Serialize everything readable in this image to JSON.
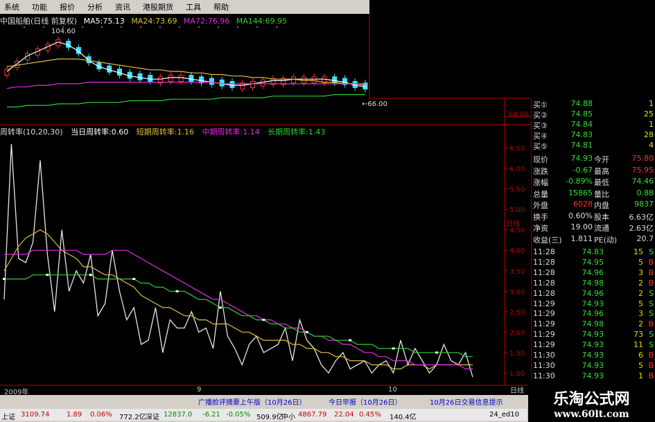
{
  "menu": [
    "系统",
    "功能",
    "报价",
    "分析",
    "资讯",
    "港股期货",
    "工具",
    "帮助"
  ],
  "kline_header": {
    "stock": "中国船舶(日线 前复权)",
    "ma5": "MA5:75.13",
    "ma24": "MA24:73.69",
    "ma72": "MA72:76.96",
    "ma144": "MA144:69.95",
    "high_mark": "104.60",
    "low_mark": "←66.00"
  },
  "indicator_header": {
    "name": "周转率(10,20,30)",
    "today": "当日周转率:0.60",
    "short": "短期周转率:1.16",
    "mid": "中期周转率:1.14",
    "long": "长期周转率:1.43"
  },
  "axis_top": {
    "label": "60.00"
  },
  "axis_indicator": [
    "6.50",
    "6.00",
    "5.50",
    "5.00",
    "4.50",
    "4.00",
    "3.50",
    "3.00",
    "2.50",
    "2.00",
    "1.50",
    "1.00"
  ],
  "axis_corner": [
    "日线",
    "日线"
  ],
  "date_axis": {
    "d1": "2009年",
    "d2": "9",
    "d3": "10"
  },
  "colors": {
    "ma5": "#ffffff",
    "ma24": "#e0c040",
    "ma72": "#e030e0",
    "ma144": "#30d030",
    "up": "#ff3030",
    "down": "#40e0ff",
    "axis": "#c00000"
  },
  "quote": {
    "bids": [
      {
        "label": "买①",
        "price": "74.88",
        "vol": "1"
      },
      {
        "label": "买②",
        "price": "74.85",
        "vol": "25"
      },
      {
        "label": "买③",
        "price": "74.84",
        "vol": "1"
      },
      {
        "label": "买④",
        "price": "74.83",
        "vol": "28"
      },
      {
        "label": "买⑤",
        "price": "74.81",
        "vol": "4"
      }
    ],
    "stats": [
      {
        "k1": "现价",
        "v1": "74.93",
        "k2": "今开",
        "v2": "75.80"
      },
      {
        "k1": "涨跌",
        "v1": "-0.67",
        "k2": "最高",
        "v2": "75.95"
      },
      {
        "k1": "涨幅",
        "v1": "-0.89%",
        "k2": "最低",
        "v2": "74.46"
      },
      {
        "k1": "总量",
        "v1": "15865",
        "k2": "量比",
        "v2": "0.88"
      },
      {
        "k1": "外盘",
        "v1": "6028",
        "k2": "内盘",
        "v2": "9837"
      },
      {
        "k1": "换手",
        "v1": "0.60%",
        "k2": "股本",
        "v2": "6.63亿"
      },
      {
        "k1": "净资",
        "v1": "19.00",
        "k2": "流通",
        "v2": "2.63亿"
      },
      {
        "k1": "收益(三)",
        "v1": "1.811",
        "k2": "PE(动)",
        "v2": "20.7"
      }
    ],
    "ticks": [
      {
        "t": "11:28",
        "p": "74.83",
        "v": "15",
        "s": "S"
      },
      {
        "t": "11:28",
        "p": "74.95",
        "v": "5",
        "s": "B"
      },
      {
        "t": "11:28",
        "p": "74.96",
        "v": "3",
        "s": "B"
      },
      {
        "t": "11:28",
        "p": "74.98",
        "v": "2",
        "s": "B"
      },
      {
        "t": "11:28",
        "p": "74.96",
        "v": "2",
        "s": "S"
      },
      {
        "t": "11:29",
        "p": "74.93",
        "v": "5",
        "s": "S"
      },
      {
        "t": "11:29",
        "p": "74.96",
        "v": "3",
        "s": "S"
      },
      {
        "t": "11:29",
        "p": "74.98",
        "v": "2",
        "s": "B"
      },
      {
        "t": "11:29",
        "p": "74.93",
        "v": "73",
        "s": "S"
      },
      {
        "t": "11:29",
        "p": "74.93",
        "v": "11",
        "s": "S"
      },
      {
        "t": "11:30",
        "p": "74.93",
        "v": "6",
        "s": "B"
      },
      {
        "t": "11:30",
        "p": "74.93",
        "v": "5",
        "s": "B"
      },
      {
        "t": "11:30",
        "p": "74.93",
        "v": "1",
        "s": "B"
      }
    ]
  },
  "news": {
    "n1": "广播脸评摘要上午版（10月26日）",
    "n2": "今日早报（10月26日）",
    "n3": "10月26日交易信息提示"
  },
  "ticker": {
    "sh_label": "上证",
    "sh_idx": "3109.74",
    "sh_chg": "1.89",
    "sh_pct": "0.06%",
    "sh_amt": "772.2亿",
    "sz_label": "深证",
    "sz_idx": "12837.0",
    "sz_chg": "-6.21",
    "sz_pct": "-0.05%",
    "sz_amt": "509.9亿",
    "zx_label": "中小",
    "zx_idx": "4867.79",
    "zx_chg": "22.04",
    "zx_pct": "0.45%",
    "zx_amt": "140.4亿",
    "code": "24_ed10"
  },
  "brand": {
    "name": "乐淘公式网",
    "url": "www.60lt.com"
  },
  "chart_data": [
    {
      "type": "line",
      "title": "周转率(10,20,30)",
      "ylim": [
        0.7,
        6.8
      ],
      "series": [
        {
          "name": "当日周转率",
          "values": [
            2.8,
            6.6,
            3.8,
            3.7,
            4.2,
            6.2,
            3.9,
            2.5,
            4.5,
            3.0,
            3.5,
            3.2,
            3.9,
            2.4,
            2.7,
            4.0,
            3.0,
            2.3,
            2.6,
            1.7,
            1.8,
            2.6,
            1.5,
            2.3,
            2.1,
            2.1,
            2.5,
            2.0,
            2.1,
            1.6,
            3.0,
            1.9,
            1.6,
            1.2,
            1.7,
            1.9,
            1.5,
            1.6,
            1.7,
            2.1,
            1.3,
            2.3,
            1.8,
            1.6,
            1.2,
            1.0,
            1.3,
            1.5,
            1.1,
            1.2,
            1.3,
            1.0,
            1.2,
            1.3,
            1.0,
            1.8,
            1.2,
            1.6,
            1.3,
            1.0,
            1.2,
            1.7,
            1.3,
            1.2,
            1.5,
            0.9
          ]
        },
        {
          "name": "短期周转率",
          "values": [
            3.5,
            3.8,
            4.1,
            4.3,
            4.4,
            4.5,
            4.4,
            4.2,
            4.0,
            3.9,
            3.8,
            3.6,
            3.6,
            3.5,
            3.4,
            3.4,
            3.3,
            3.2,
            3.1,
            2.9,
            2.8,
            2.7,
            2.6,
            2.6,
            2.5,
            2.4,
            2.4,
            2.3,
            2.3,
            2.2,
            2.2,
            2.2,
            2.1,
            2.0,
            2.0,
            1.9,
            1.8,
            1.8,
            1.8,
            1.8,
            1.7,
            1.7,
            1.6,
            1.6,
            1.5,
            1.5,
            1.4,
            1.4,
            1.3,
            1.3,
            1.3,
            1.2,
            1.2,
            1.2,
            1.1,
            1.1,
            1.2,
            1.2,
            1.2,
            1.1,
            1.2,
            1.2,
            1.2,
            1.2,
            1.2,
            1.2
          ]
        },
        {
          "name": "中期周转率",
          "values": [
            3.9,
            3.9,
            3.9,
            3.9,
            4.0,
            4.0,
            4.0,
            4.0,
            4.0,
            4.0,
            4.0,
            3.9,
            3.9,
            3.9,
            3.9,
            4.0,
            4.0,
            4.0,
            3.9,
            3.8,
            3.7,
            3.6,
            3.5,
            3.4,
            3.3,
            3.2,
            3.1,
            3.0,
            2.9,
            2.8,
            2.8,
            2.7,
            2.6,
            2.5,
            2.4,
            2.4,
            2.3,
            2.3,
            2.2,
            2.2,
            2.1,
            2.1,
            2.0,
            1.9,
            1.9,
            1.8,
            1.8,
            1.7,
            1.7,
            1.6,
            1.5,
            1.5,
            1.4,
            1.4,
            1.3,
            1.3,
            1.3,
            1.2,
            1.2,
            1.2,
            1.2,
            1.2,
            1.2,
            1.2,
            1.1,
            1.1
          ]
        },
        {
          "name": "长期周转率",
          "values": [
            3.3,
            3.3,
            3.3,
            3.3,
            3.4,
            3.4,
            3.4,
            3.4,
            3.4,
            3.4,
            3.4,
            3.4,
            3.4,
            3.3,
            3.3,
            3.3,
            3.3,
            3.3,
            3.3,
            3.2,
            3.2,
            3.1,
            3.1,
            3.0,
            3.0,
            3.0,
            2.9,
            2.8,
            2.8,
            2.7,
            2.6,
            2.6,
            2.5,
            2.4,
            2.4,
            2.3,
            2.3,
            2.2,
            2.2,
            2.1,
            2.1,
            2.0,
            2.0,
            1.9,
            1.9,
            1.9,
            1.8,
            1.8,
            1.8,
            1.7,
            1.7,
            1.7,
            1.6,
            1.6,
            1.6,
            1.6,
            1.6,
            1.5,
            1.5,
            1.5,
            1.5,
            1.5,
            1.5,
            1.5,
            1.4,
            1.4
          ]
        }
      ]
    },
    {
      "type": "line",
      "title": "中国船舶(日线 前复权)",
      "ylim": [
        55,
        115
      ],
      "series": [
        {
          "name": "MA5",
          "values": [
            85,
            90,
            95,
            98,
            101,
            104,
            102,
            98,
            92,
            88,
            86,
            84,
            82,
            81,
            80,
            80,
            81,
            81,
            80,
            79,
            78,
            77,
            76,
            76,
            77,
            78,
            79,
            79,
            80,
            80,
            80,
            80,
            79,
            78,
            76,
            75
          ]
        },
        {
          "name": "MA24",
          "values": [
            88,
            89,
            90,
            91,
            92,
            93,
            93,
            93,
            92,
            91,
            90,
            89,
            88,
            87,
            86,
            86,
            85,
            85,
            84,
            84,
            83,
            83,
            82,
            82,
            81,
            81,
            80,
            80,
            80,
            79,
            79,
            78,
            78,
            77,
            77,
            76
          ]
        },
        {
          "name": "MA72",
          "values": [
            74,
            75,
            75,
            76,
            76,
            77,
            77,
            77,
            78,
            78,
            78,
            78,
            78,
            78,
            78,
            78,
            78,
            78,
            78,
            78,
            78,
            77,
            77,
            77,
            77,
            77,
            77,
            77,
            77,
            77,
            77,
            77,
            77,
            77,
            77,
            77
          ]
        },
        {
          "name": "MA144",
          "values": [
            62,
            62,
            63,
            63,
            63,
            64,
            64,
            64,
            65,
            65,
            65,
            65,
            66,
            66,
            66,
            66,
            67,
            67,
            67,
            67,
            67,
            68,
            68,
            68,
            68,
            68,
            69,
            69,
            69,
            69,
            69,
            69,
            70,
            70,
            70,
            70
          ]
        }
      ]
    }
  ]
}
